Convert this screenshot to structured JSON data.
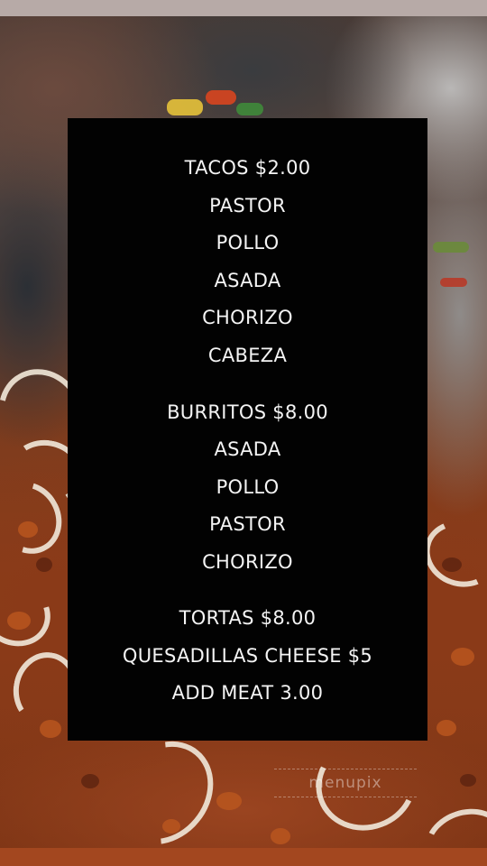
{
  "menu": {
    "tacos": {
      "header": "TACOS $2.00",
      "items": [
        "PASTOR",
        "POLLO",
        "ASADA",
        "CHORIZO",
        "CABEZA"
      ]
    },
    "burritos": {
      "header": "BURRITOS $8.00",
      "items": [
        "ASADA",
        "POLLO",
        "PASTOR",
        "CHORIZO"
      ]
    },
    "extras": {
      "lines": [
        "TORTAS $8.00",
        "QUESADILLAS CHEESE $5",
        "ADD MEAT 3.00"
      ]
    }
  },
  "watermark": "menupix",
  "colors": {
    "panel": "#020202",
    "text": "#f4f4f4",
    "meat": "#8c3d1a",
    "onion": "#efe5d6"
  }
}
